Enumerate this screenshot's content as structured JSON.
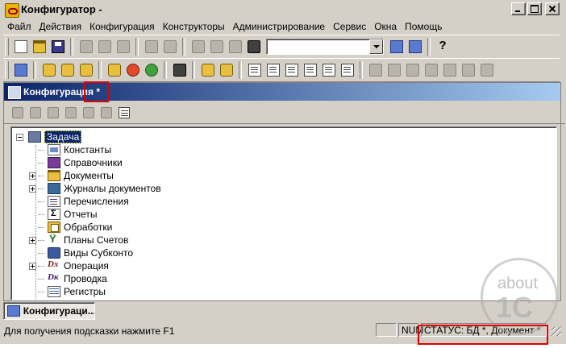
{
  "window": {
    "title": "Конфигуратор -"
  },
  "menu": [
    "Файл",
    "Действия",
    "Конфигурация",
    "Конструкторы",
    "Администрирование",
    "Сервис",
    "Окна",
    "Помощь"
  ],
  "search": {
    "value": ""
  },
  "config_window": {
    "title": "Конфигурация *"
  },
  "tree": {
    "root": "Задача",
    "items": [
      {
        "label": "Константы",
        "expandable": false
      },
      {
        "label": "Справочники",
        "expandable": false
      },
      {
        "label": "Документы",
        "expandable": true
      },
      {
        "label": "Журналы документов",
        "expandable": true
      },
      {
        "label": "Перечисления",
        "expandable": false
      },
      {
        "label": "Отчеты",
        "expandable": false
      },
      {
        "label": "Обработки",
        "expandable": false
      },
      {
        "label": "Планы Счетов",
        "expandable": true
      },
      {
        "label": "Виды Субконто",
        "expandable": false
      },
      {
        "label": "Операция",
        "expandable": true
      },
      {
        "label": "Проводка",
        "expandable": false
      },
      {
        "label": "Регистры",
        "expandable": false
      }
    ]
  },
  "taskbar": {
    "item": "Конфигураци..."
  },
  "statusbar": {
    "hint": "Для получения подсказки нажмите F1",
    "panel_num": "NUM",
    "status": "СТАТУС: БД *, Документ *"
  },
  "watermark": {
    "about": "about",
    "brand": "1C"
  },
  "colors": {
    "highlight": "#e00000",
    "selection": "#0a246a"
  }
}
